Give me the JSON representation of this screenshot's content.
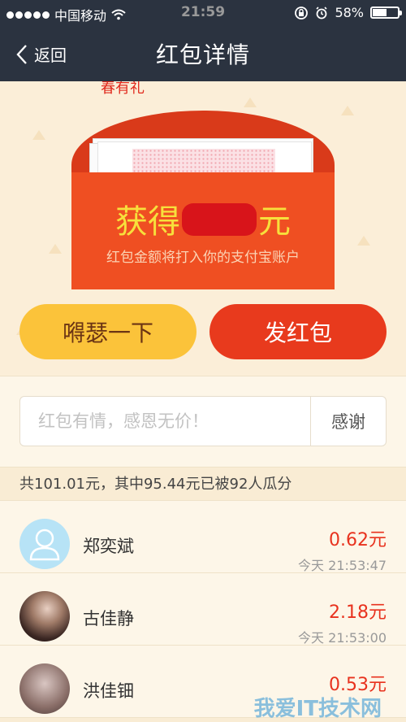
{
  "status_bar": {
    "carrier": "中国移动",
    "time": "21:59",
    "battery": "58%",
    "battery_level": 0.58
  },
  "nav": {
    "back_label": "返回",
    "title": "红包详情"
  },
  "envelope": {
    "caption": "春有礼",
    "amount_prefix": "获得",
    "amount_suffix": "元",
    "subtitle": "红包金额将打入你的支付宝账户"
  },
  "actions": {
    "share_label": "嘚瑟一下",
    "send_label": "发红包"
  },
  "thanks": {
    "placeholder": "红包有情，感恩无价！",
    "button_label": "感谢"
  },
  "summary": "共101.01元，其中95.44元已被92人瓜分",
  "recipients": [
    {
      "name": "郑奕斌",
      "amount": "0.62元",
      "time": "今天 21:53:47"
    },
    {
      "name": "古佳静",
      "amount": "2.18元",
      "time": "今天 21:53:00"
    },
    {
      "name": "洪佳钿",
      "amount": "0.53元",
      "time": ""
    }
  ],
  "watermark": "我爱IT技术网"
}
